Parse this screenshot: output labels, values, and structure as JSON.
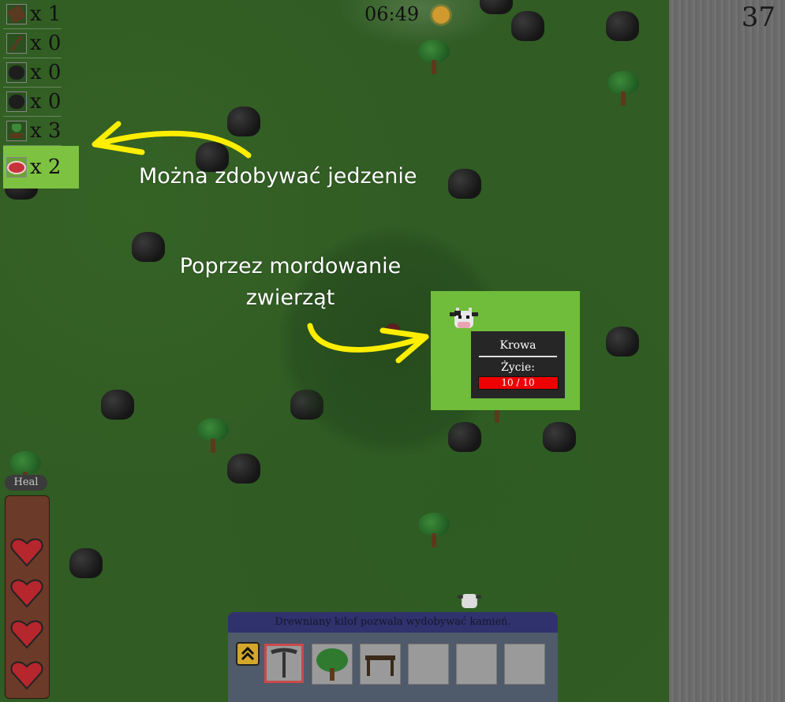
{
  "hud": {
    "clock": "06:49",
    "score": "37"
  },
  "inventory": [
    {
      "icon": "log-icon",
      "count": "x 1"
    },
    {
      "icon": "stick-icon",
      "count": "x 0"
    },
    {
      "icon": "stone-icon",
      "count": "x 0"
    },
    {
      "icon": "coal-icon",
      "count": "x 0"
    },
    {
      "icon": "sapling-icon",
      "count": "x 3"
    },
    {
      "icon": "meat-icon",
      "count": "x 2",
      "active": true
    }
  ],
  "annotations": {
    "food": "Można zdobywać jedzenie",
    "killing_line1": "Poprzez mordowanie",
    "killing_line2": "zwierząt"
  },
  "tooltip": {
    "title": "Krowa",
    "health_label": "Życie:",
    "health_value": "10 / 10",
    "health_fraction": 1.0
  },
  "player": {
    "heal_label": "Heal",
    "hearts": 4
  },
  "hotbar": {
    "hint": "Drewniany kilof pozwala wydobywać kamień.",
    "slots": [
      "pickaxe-icon",
      "tree-icon",
      "workbench-icon",
      "",
      "",
      ""
    ],
    "selected_index": 0
  },
  "colors": {
    "grass": "#315c24",
    "highlight": "#6fbd3a",
    "annotation_arrow": "#ffee00",
    "health_bar": "#ee0000"
  }
}
